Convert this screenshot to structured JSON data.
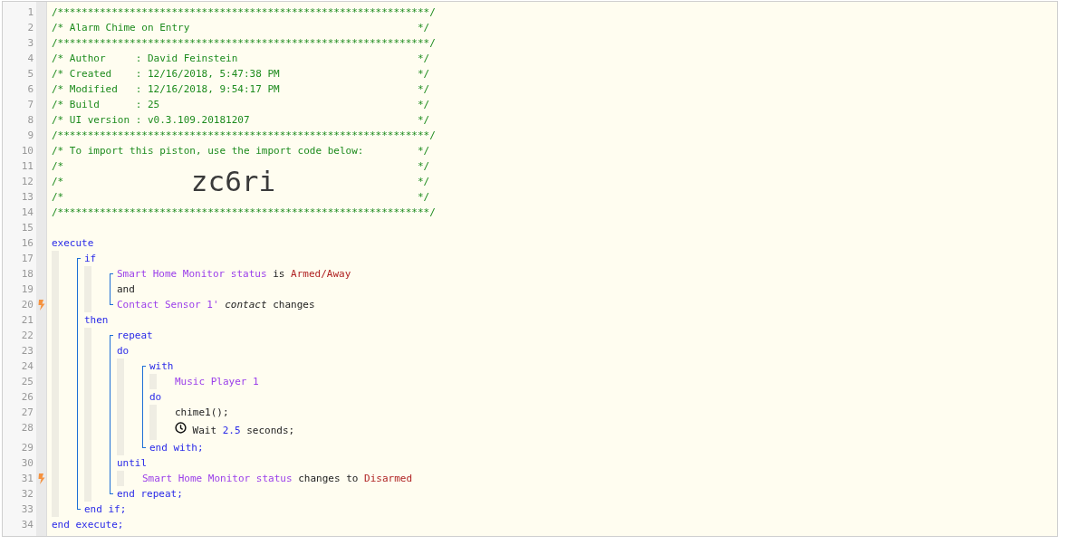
{
  "code": [
    {
      "kind": "line",
      "number": "1",
      "trigger": false,
      "tokens": [
        {
          "kind": "comment",
          "text": "/**************************************************************/"
        }
      ]
    },
    {
      "kind": "line",
      "number": "2",
      "trigger": false,
      "tokens": [
        {
          "kind": "comment",
          "text": "/* Alarm Chime on Entry"
        },
        {
          "kind": "comment_end",
          "text": "*/"
        }
      ]
    },
    {
      "kind": "line",
      "number": "3",
      "trigger": false,
      "tokens": [
        {
          "kind": "comment",
          "text": "/**************************************************************/"
        }
      ]
    },
    {
      "kind": "line",
      "number": "4",
      "trigger": false,
      "tokens": [
        {
          "kind": "comment",
          "text": "/* Author     : David Feinstein"
        },
        {
          "kind": "comment_end",
          "text": "*/"
        }
      ]
    },
    {
      "kind": "line",
      "number": "5",
      "trigger": false,
      "tokens": [
        {
          "kind": "comment",
          "text": "/* Created    : 12/16/2018, 5:47:38 PM"
        },
        {
          "kind": "comment_end",
          "text": "*/"
        }
      ]
    },
    {
      "kind": "line",
      "number": "6",
      "trigger": false,
      "tokens": [
        {
          "kind": "comment",
          "text": "/* Modified   : 12/16/2018, 9:54:17 PM"
        },
        {
          "kind": "comment_end",
          "text": "*/"
        }
      ]
    },
    {
      "kind": "line",
      "number": "7",
      "trigger": false,
      "tokens": [
        {
          "kind": "comment",
          "text": "/* Build      : 25"
        },
        {
          "kind": "comment_end",
          "text": "*/"
        }
      ]
    },
    {
      "kind": "line",
      "number": "8",
      "trigger": false,
      "tokens": [
        {
          "kind": "comment",
          "text": "/* UI version : v0.3.109.20181207"
        },
        {
          "kind": "comment_end",
          "text": "*/"
        }
      ]
    },
    {
      "kind": "line",
      "number": "9",
      "trigger": false,
      "tokens": [
        {
          "kind": "comment",
          "text": "/**************************************************************/"
        }
      ]
    },
    {
      "kind": "line",
      "number": "10",
      "trigger": false,
      "tokens": [
        {
          "kind": "comment",
          "text": "/* To import this piston, use the import code below:"
        },
        {
          "kind": "comment_end",
          "text": "*/"
        }
      ]
    },
    {
      "kind": "line",
      "number": "11",
      "trigger": false,
      "tokens": [
        {
          "kind": "comment",
          "text": "/*"
        },
        {
          "kind": "comment_end",
          "text": "*/"
        }
      ]
    },
    {
      "kind": "line",
      "number": "12",
      "trigger": false,
      "tokens": [
        {
          "kind": "comment",
          "text": "/*"
        },
        {
          "kind": "import_code",
          "text": "zc6ri"
        },
        {
          "kind": "comment_end",
          "text": "*/"
        }
      ]
    },
    {
      "kind": "line",
      "number": "13",
      "trigger": false,
      "tokens": [
        {
          "kind": "comment",
          "text": "/*"
        },
        {
          "kind": "comment_end",
          "text": "*/"
        }
      ]
    },
    {
      "kind": "line",
      "number": "14",
      "trigger": false,
      "tokens": [
        {
          "kind": "comment",
          "text": "/**************************************************************/"
        }
      ]
    },
    {
      "kind": "line",
      "number": "15",
      "trigger": false
    },
    {
      "kind": "line",
      "number": "16",
      "trigger": false,
      "tokens": [
        {
          "kind": "keyword",
          "text": "execute"
        }
      ]
    },
    {
      "kind": "body",
      "children": [
        {
          "kind": "bracket",
          "children": [
            {
              "kind": "line",
              "number": "17",
              "trigger": false,
              "tokens": [
                {
                  "kind": "keyword",
                  "text": "if"
                }
              ]
            },
            {
              "kind": "body",
              "children": [
                {
                  "kind": "bracket",
                  "children": [
                    {
                      "kind": "line",
                      "number": "18",
                      "trigger": false,
                      "tokens": [
                        {
                          "kind": "device",
                          "text": "Smart Home Monitor status"
                        },
                        {
                          "kind": "plain",
                          "text": "is"
                        },
                        {
                          "kind": "value",
                          "text": "Armed/Away"
                        }
                      ]
                    },
                    {
                      "kind": "line",
                      "number": "19",
                      "trigger": false,
                      "tokens": [
                        {
                          "kind": "plain",
                          "text": "and"
                        }
                      ]
                    },
                    {
                      "kind": "line",
                      "number": "20",
                      "trigger": true,
                      "tokens": [
                        {
                          "kind": "device",
                          "text": "Contact Sensor 1'"
                        },
                        {
                          "kind": "attribute",
                          "text": "contact"
                        },
                        {
                          "kind": "plain",
                          "text": "changes"
                        }
                      ]
                    }
                  ]
                }
              ]
            },
            {
              "kind": "line",
              "number": "21",
              "trigger": false,
              "tokens": [
                {
                  "kind": "keyword",
                  "text": "then"
                }
              ]
            },
            {
              "kind": "body",
              "children": [
                {
                  "kind": "bracket",
                  "children": [
                    {
                      "kind": "line",
                      "number": "22",
                      "trigger": false,
                      "tokens": [
                        {
                          "kind": "keyword",
                          "text": "repeat"
                        }
                      ]
                    },
                    {
                      "kind": "line",
                      "number": "23",
                      "trigger": false,
                      "tokens": [
                        {
                          "kind": "keyword",
                          "text": "do"
                        }
                      ]
                    },
                    {
                      "kind": "body",
                      "children": [
                        {
                          "kind": "bracket",
                          "children": [
                            {
                              "kind": "line",
                              "number": "24",
                              "trigger": false,
                              "tokens": [
                                {
                                  "kind": "keyword",
                                  "text": "with"
                                }
                              ]
                            },
                            {
                              "kind": "body",
                              "children": [
                                {
                                  "kind": "line",
                                  "number": "25",
                                  "trigger": false,
                                  "tokens": [
                                    {
                                      "kind": "device",
                                      "text": "Music Player 1"
                                    }
                                  ]
                                }
                              ]
                            },
                            {
                              "kind": "line",
                              "number": "26",
                              "trigger": false,
                              "tokens": [
                                {
                                  "kind": "keyword",
                                  "text": "do"
                                }
                              ]
                            },
                            {
                              "kind": "body",
                              "children": [
                                {
                                  "kind": "line",
                                  "number": "27",
                                  "trigger": false,
                                  "tokens": [
                                    {
                                      "kind": "plain",
                                      "text": "chime1();"
                                    }
                                  ]
                                },
                                {
                                  "kind": "line",
                                  "number": "28",
                                  "trigger": false,
                                  "tokens": [
                                    {
                                      "kind": "clock"
                                    },
                                    {
                                      "kind": "plain",
                                      "text": "Wait"
                                    },
                                    {
                                      "kind": "number",
                                      "text": "2.5"
                                    },
                                    {
                                      "kind": "plain",
                                      "text": "seconds;"
                                    }
                                  ]
                                }
                              ]
                            },
                            {
                              "kind": "line",
                              "number": "29",
                              "trigger": false,
                              "tokens": [
                                {
                                  "kind": "keyword",
                                  "text": "end with;"
                                }
                              ]
                            }
                          ]
                        }
                      ]
                    },
                    {
                      "kind": "line",
                      "number": "30",
                      "trigger": false,
                      "tokens": [
                        {
                          "kind": "keyword",
                          "text": "until"
                        }
                      ]
                    },
                    {
                      "kind": "body",
                      "children": [
                        {
                          "kind": "line",
                          "number": "31",
                          "trigger": true,
                          "tokens": [
                            {
                              "kind": "device",
                              "text": "Smart Home Monitor status"
                            },
                            {
                              "kind": "plain",
                              "text": "changes to"
                            },
                            {
                              "kind": "value",
                              "text": "Disarmed"
                            }
                          ]
                        }
                      ]
                    },
                    {
                      "kind": "line",
                      "number": "32",
                      "trigger": false,
                      "tokens": [
                        {
                          "kind": "keyword",
                          "text": "end repeat;"
                        }
                      ]
                    }
                  ]
                }
              ]
            },
            {
              "kind": "line",
              "number": "33",
              "trigger": false,
              "tokens": [
                {
                  "kind": "keyword",
                  "text": "end if;"
                }
              ]
            }
          ]
        }
      ]
    },
    {
      "kind": "line",
      "number": "34",
      "trigger": false,
      "tokens": [
        {
          "kind": "keyword",
          "text": "end execute;"
        }
      ]
    }
  ]
}
